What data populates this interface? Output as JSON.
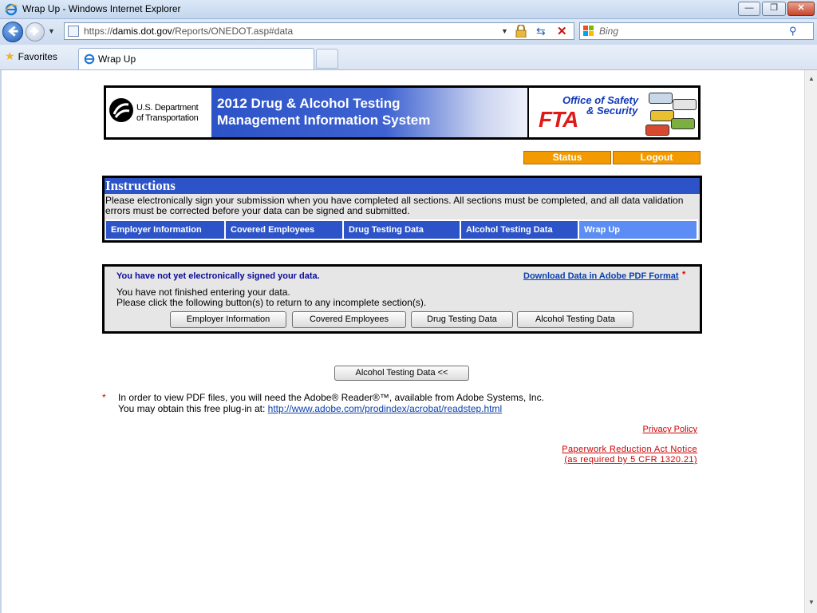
{
  "window": {
    "title": "Wrap Up - Windows Internet Explorer",
    "minimize": "—",
    "maximize": "❐",
    "close": "✕"
  },
  "address": {
    "url_prefix": "https://",
    "url_host": "damis.dot.gov",
    "url_path": "/Reports/ONEDOT.asp#data"
  },
  "search": {
    "placeholder": "Bing"
  },
  "favorites": {
    "label": "Favorites"
  },
  "tab": {
    "label": "Wrap Up"
  },
  "banner": {
    "dot_line1": "U.S. Department",
    "dot_line2": "of Transportation",
    "title_line1": "2012 Drug & Alcohol Testing",
    "title_line2": "Management Information System",
    "oss_line1": "Office of Safety",
    "oss_line2": "& Security",
    "fta": "FTA"
  },
  "nav": {
    "status": "Status",
    "logout": "Logout"
  },
  "instructions": {
    "heading": "Instructions",
    "text": "Please electronically sign your submission when you have completed all sections.  All sections must be completed, and all data validation errors must be corrected before your data can be signed and submitted."
  },
  "sections": [
    {
      "label": "Employer Information"
    },
    {
      "label": "Covered Employees"
    },
    {
      "label": "Drug Testing Data"
    },
    {
      "label": "Alcohol Testing Data"
    },
    {
      "label": "Wrap Up"
    }
  ],
  "wrapup": {
    "not_signed": "You have not yet electronically signed your data.",
    "pdf_link": "Download Data in Adobe PDF Format",
    "pdf_asterisk": "*",
    "not_finished_1": "You have not finished entering your data.",
    "not_finished_2": "Please click the following button(s) to return to any incomplete section(s).",
    "buttons": [
      "Employer Information",
      "Covered Employees",
      "Drug Testing Data",
      "Alcohol Testing Data"
    ]
  },
  "back_button": "Alcohol Testing Data <<",
  "footnote": {
    "asterisk": "*",
    "line1": "In order to view PDF files, you will need the Adobe® Reader®™, available from Adobe Systems, Inc.",
    "line2_prefix": "You may obtain this free plug-in at: ",
    "line2_link": "http://www.adobe.com/prodindex/acrobat/readstep.html"
  },
  "links": {
    "privacy": "Privacy Policy",
    "paperwork_1": "Paperwork Reduction Act Notice",
    "paperwork_2": "(as required by 5 CFR 1320.21)"
  }
}
